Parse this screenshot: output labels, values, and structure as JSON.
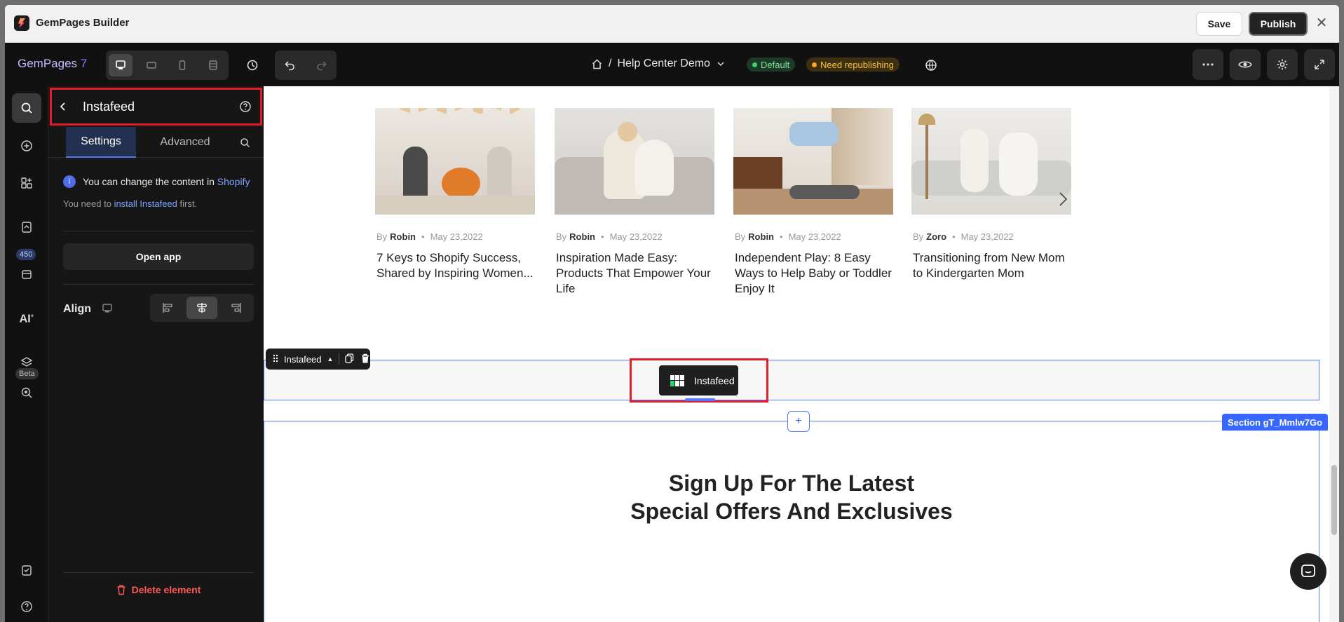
{
  "app": {
    "title": "GemPages Builder",
    "save_label": "Save",
    "publish_label": "Publish"
  },
  "toolbar": {
    "brand": "GemPages",
    "brand_version": "7",
    "breadcrumb_sep": "/",
    "page_name": "Help Center Demo",
    "badge_default": "Default",
    "badge_need": "Need republishing"
  },
  "rail": {
    "badge_count": "450",
    "beta": "Beta"
  },
  "panel": {
    "title": "Instafeed",
    "tabs": [
      "Settings",
      "Advanced"
    ],
    "info_text": "You can change the content in",
    "info_link": "Shopify",
    "install_prefix": "You need to",
    "install_link": "install Instafeed",
    "install_suffix": "first.",
    "open_app": "Open app",
    "align_label": "Align",
    "delete_label": "Delete element"
  },
  "blogs": [
    {
      "by": "By",
      "author": "Robin",
      "date": "May 23,2022",
      "title": "7 Keys to Shopify Success, Shared by Inspiring Women..."
    },
    {
      "by": "By",
      "author": "Robin",
      "date": "May 23,2022",
      "title": "Inspiration Made Easy: Products That Empower Your Life"
    },
    {
      "by": "By",
      "author": "Robin",
      "date": "May 23,2022",
      "title": "Independent Play: 8 Easy Ways to Help Baby or Toddler Enjoy It"
    },
    {
      "by": "By",
      "author": "Zoro",
      "date": "May 23,2022",
      "title": "Transitioning from New Mom to Kindergarten Mom"
    }
  ],
  "canvas": {
    "selected_label": "Instafeed",
    "widget_label": "Instafeed",
    "section_tag": "Section gT_Mmlw7Go",
    "signup_line1": "Sign Up For The Latest",
    "signup_line2": "Special Offers And Exclusives"
  },
  "colors": {
    "accent": "#3767ff",
    "highlight": "#e11d2a",
    "dark": "#111111"
  }
}
